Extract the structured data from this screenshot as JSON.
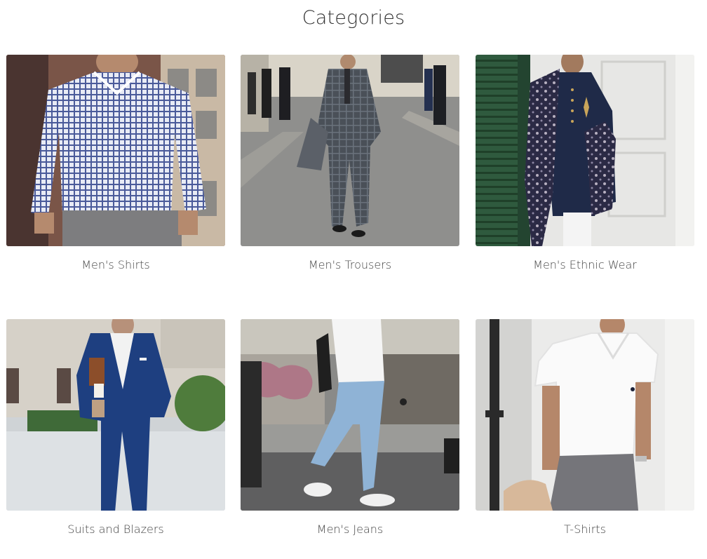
{
  "page": {
    "title": "Categories"
  },
  "categories": [
    {
      "label": "Men's Shirts"
    },
    {
      "label": "Men's Trousers"
    },
    {
      "label": "Men's Ethnic Wear"
    },
    {
      "label": "Suits and Blazers"
    },
    {
      "label": "Men's Jeans"
    },
    {
      "label": "T-Shirts"
    }
  ]
}
